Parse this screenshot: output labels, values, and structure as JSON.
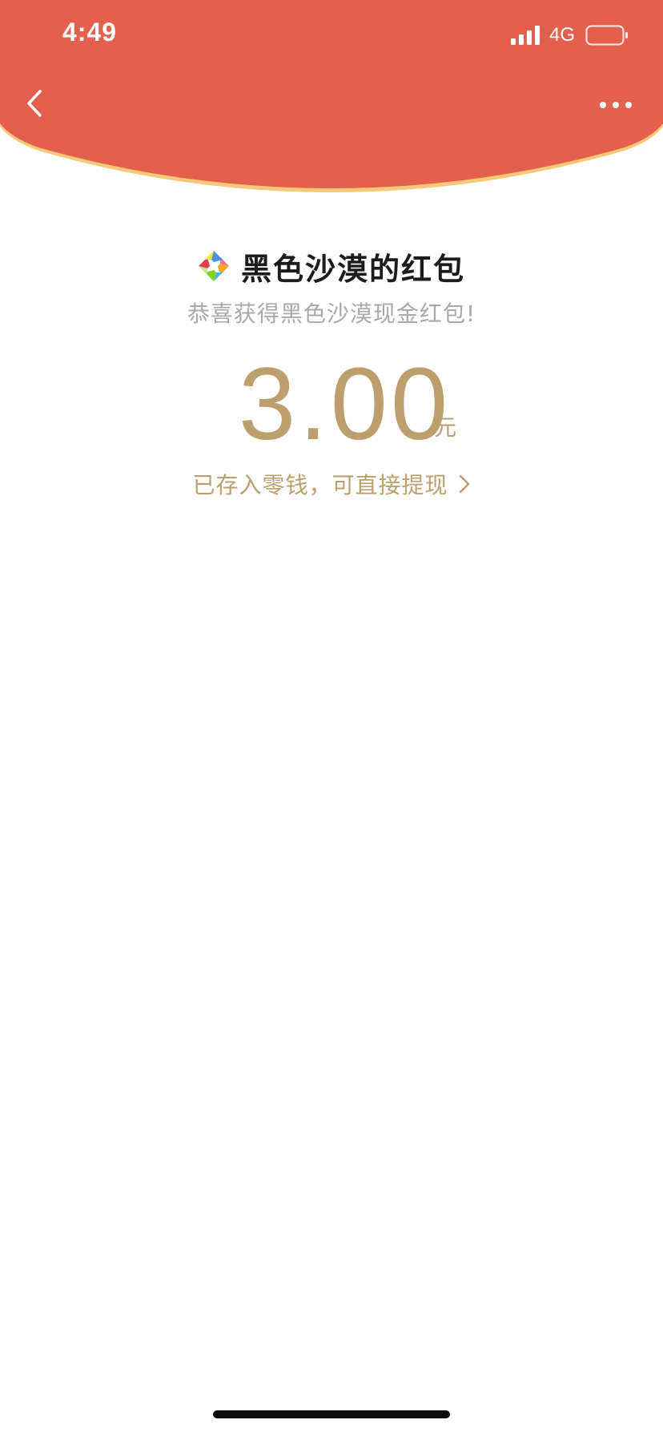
{
  "status_bar": {
    "time": "4:49",
    "network": "4G",
    "signal_icon": "signal-bars-icon",
    "battery_icon": "battery-icon"
  },
  "nav": {
    "back_icon": "chevron-left-icon",
    "more_icon": "more-dots-icon"
  },
  "colors": {
    "header_red": "#E2604D",
    "header_rim": "#F5C97A",
    "gold_text": "#BC9F6D",
    "title_text": "#1C1C1C",
    "subtitle_text": "#A9A9A9"
  },
  "envelope": {
    "sender_logo": "sender-logo-icon",
    "sender_title": "黑色沙漠的红包",
    "greeting": "恭喜获得黑色沙漠现金红包!",
    "amount": "3.00",
    "unit": "元",
    "wallet_link": "已存入零钱，可直接提现",
    "wallet_chevron": "chevron-right-icon"
  }
}
